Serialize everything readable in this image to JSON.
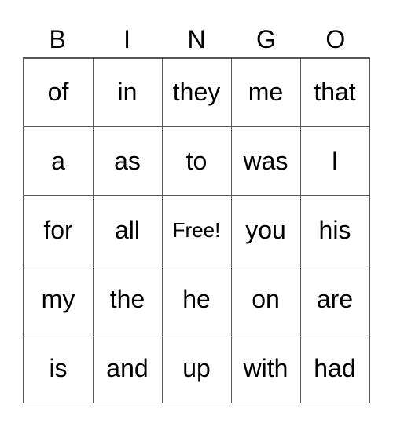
{
  "header": [
    "B",
    "I",
    "N",
    "G",
    "O"
  ],
  "rows": [
    [
      "of",
      "in",
      "they",
      "me",
      "that"
    ],
    [
      "a",
      "as",
      "to",
      "was",
      "I"
    ],
    [
      "for",
      "all",
      "Free!",
      "you",
      "his"
    ],
    [
      "my",
      "the",
      "he",
      "on",
      "are"
    ],
    [
      "is",
      "and",
      "up",
      "with",
      "had"
    ]
  ]
}
